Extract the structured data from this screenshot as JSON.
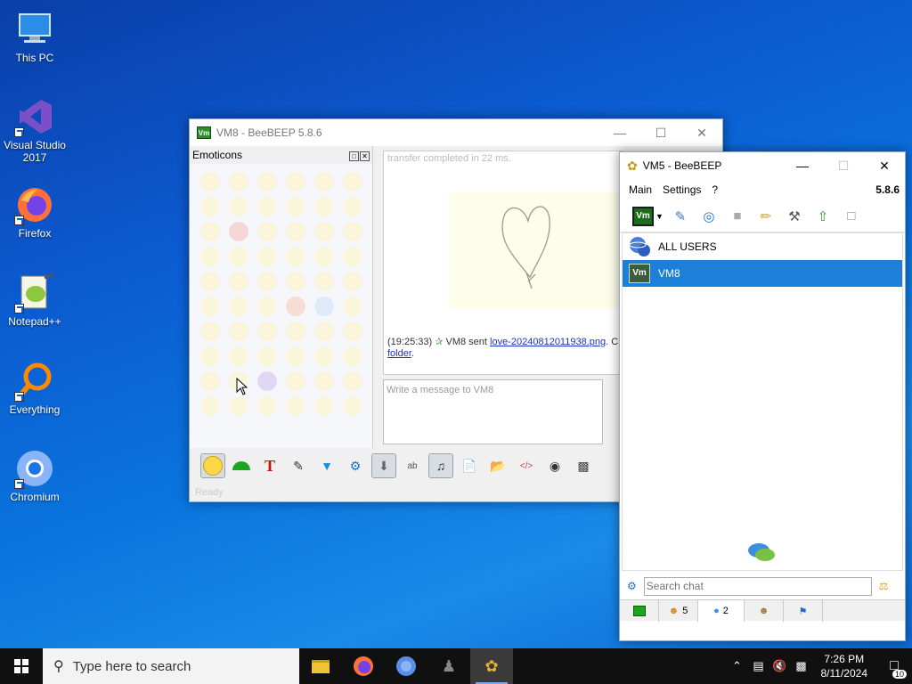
{
  "desktop": {
    "icons": [
      {
        "label": "This PC",
        "icon": "computer-icon"
      },
      {
        "label": "Visual Studio 2017",
        "icon": "visual-studio-icon"
      },
      {
        "label": "Firefox",
        "icon": "firefox-icon"
      },
      {
        "label": "Notepad++",
        "icon": "notepadpp-icon"
      },
      {
        "label": "Everything",
        "icon": "everything-search-icon"
      },
      {
        "label": "Chromium",
        "icon": "chromium-icon"
      }
    ]
  },
  "chat_window": {
    "title": "VM8 - BeeBEEP 5.8.6",
    "icon_text": "Vm",
    "emoticons_title": "Emoticons",
    "chat_top_text": "transfer completed in 22 ms.",
    "message": {
      "time": "(19:25:33)",
      "sender_text": "VM8 sent",
      "file_link": "love-20240812011938.png",
      "after_link": ". C",
      "folder_link": "folder"
    },
    "compose_placeholder": "Write a message to VM8",
    "status_text": "Ready"
  },
  "vm5_window": {
    "title": "VM5 - BeeBEEP",
    "menu": [
      "Main",
      "Settings",
      "?"
    ],
    "version": "5.8.6",
    "status_badge": "Vm",
    "users": [
      {
        "name": "ALL USERS",
        "selected": false
      },
      {
        "name": "VM8",
        "selected": true,
        "badge": "Vm"
      }
    ],
    "search_placeholder": "Search chat",
    "tabs": [
      {
        "icon": "home-icon",
        "count": ""
      },
      {
        "icon": "users-icon",
        "count": "5"
      },
      {
        "icon": "chats-icon",
        "count": "2"
      },
      {
        "icon": "groups-icon",
        "count": ""
      },
      {
        "icon": "flag-icon",
        "count": ""
      }
    ]
  },
  "taskbar": {
    "search_placeholder": "Type here to search",
    "time": "7:26 PM",
    "date": "8/11/2024",
    "notification_count": "10"
  }
}
